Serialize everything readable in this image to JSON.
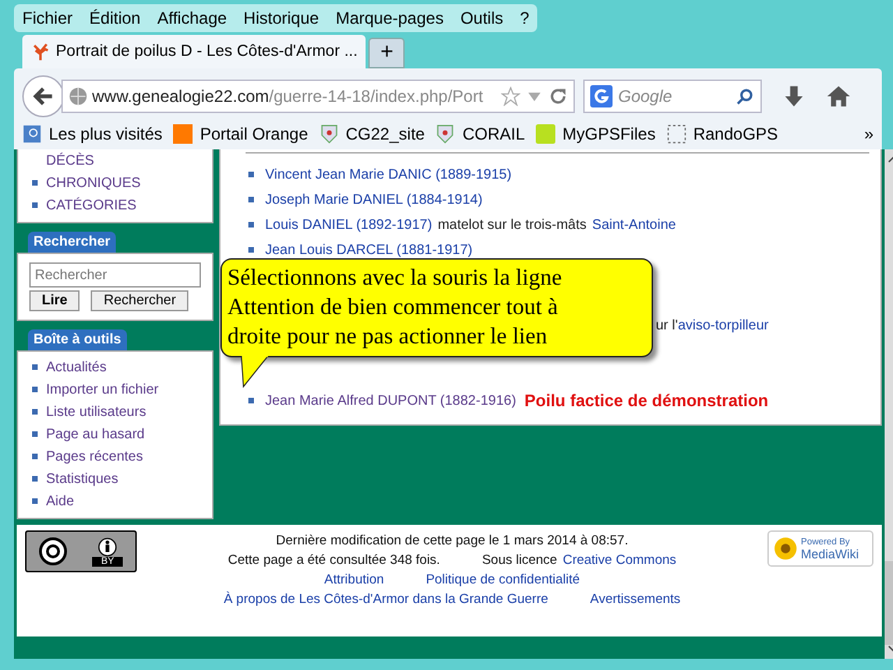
{
  "menu": [
    "Fichier",
    "Édition",
    "Affichage",
    "Historique",
    "Marque-pages",
    "Outils",
    "?"
  ],
  "tabs": [
    {
      "title": "Portrait de poilus D - Les Côtes-d'Armor ...",
      "selected": true
    }
  ],
  "new_tab": "+",
  "address": {
    "domain": "www.genealogie22.com",
    "path": "/guerre-14-18/index.php/Port"
  },
  "search": {
    "placeholder": "Google"
  },
  "bookmarks": [
    {
      "label": "Les plus visités",
      "kind": "history"
    },
    {
      "label": "Portail Orange",
      "kind": "orange"
    },
    {
      "label": "CG22_site",
      "kind": "crest"
    },
    {
      "label": "CORAIL",
      "kind": "crest"
    },
    {
      "label": "MyGPSFiles",
      "kind": "gps"
    },
    {
      "label": "RandoGPS",
      "kind": "blank"
    }
  ],
  "bookmarks_more": "»",
  "sidebar": {
    "nav_items": [
      {
        "label": "DÉCÈS",
        "bullet": false
      },
      {
        "label": "CHRONIQUES",
        "bullet": true
      },
      {
        "label": "CATÉGORIES",
        "bullet": true
      }
    ],
    "search_portlet": {
      "title": "Rechercher",
      "placeholder": "Rechercher",
      "buttons": [
        "Lire",
        "Rechercher"
      ]
    },
    "toolbox": {
      "title": "Boîte à outils",
      "items": [
        "Actualités",
        "Importer un fichier",
        "Liste utilisateurs",
        "Page au hasard",
        "Pages récentes",
        "Statistiques",
        "Aide"
      ]
    }
  },
  "rows": [
    {
      "kind": "entry",
      "name": "Vincent Jean Marie DANIC (1889-1915)",
      "visited": false
    },
    {
      "kind": "entry",
      "name": "Joseph Marie DANIEL (1884-1914)",
      "visited": false
    },
    {
      "kind": "entry",
      "name": "Louis DANIEL (1892-1917)",
      "visited": false,
      "note": "matelot sur le trois-mâts",
      "note_link": "Saint-Antoine"
    },
    {
      "kind": "entry",
      "name": "Jean Louis DARCEL (1881-1917)",
      "visited": false
    },
    {
      "kind": "hidden"
    },
    {
      "kind": "hidden"
    },
    {
      "kind": "fragment",
      "note": "ur l'",
      "note_link": "aviso-torpilleur"
    },
    {
      "kind": "hidden"
    },
    {
      "kind": "hidden"
    },
    {
      "kind": "entry",
      "name": "Jean Marie Alfred DUPONT (1882-1916)",
      "visited": true,
      "annotation": "Poilu factice de démonstration"
    }
  ],
  "callout": [
    "Sélectionnons avec la souris la ligne",
    "Attention de bien commencer tout à",
    "droite pour ne pas actionner le lien"
  ],
  "footer": {
    "modified": "Dernière modification de cette page le 1 mars 2014 à 08:57.",
    "views": "Cette page a été consultée 348 fois.",
    "license_prefix": "Sous licence",
    "license_link": "Creative Commons",
    "links": [
      "Attribution",
      "Politique de confidentialité",
      "À propos de Les Côtes-d'Armor dans la Grande Guerre",
      "Avertissements"
    ],
    "cc_badge": "BY",
    "powered_by": [
      "Powered By",
      "MediaWiki"
    ]
  }
}
